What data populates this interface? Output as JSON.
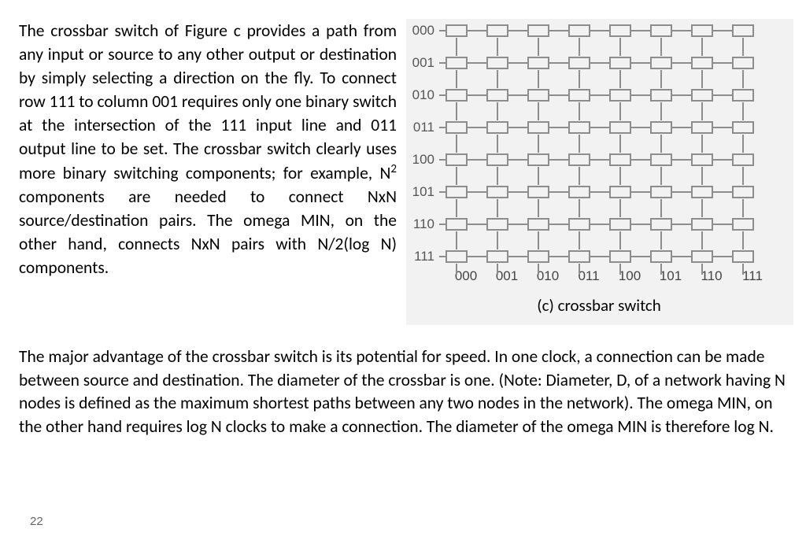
{
  "paragraph1": {
    "t1": "The crossbar switch of Figure  c provides a path from any input or source to any other output or destination by simply selecting a direction on the fly. To connect row 111 to column 001 requires only one binary switch at the intersection of the 111 input line and 011 output line to be set. The crossbar switch clearly uses more binary switching components; for example, N",
    "sup": "2",
    "t2": " components are needed to connect NxN source/destination pairs. The omega MIN, on the other hand, connects NxN pairs with N/2(log N) components."
  },
  "figure": {
    "row_labels": [
      "000",
      "001",
      "010",
      "011",
      "100",
      "101",
      "110",
      "111"
    ],
    "col_labels": [
      "000",
      "001",
      "010",
      "011",
      "100",
      "101",
      "110",
      "111"
    ],
    "caption": "(c) crossbar switch"
  },
  "paragraph2": "The major advantage of the crossbar switch is its potential for speed. In one clock, a connection can be made between source and destination. The diameter of the crossbar is one. (Note: Diameter, D, of a network having N nodes is defined as the maximum shortest paths between any two nodes in the network). The omega MIN, on the other hand requires log N clocks to make a connection. The diameter of the omega MIN is therefore log N.",
  "page_number": "22"
}
